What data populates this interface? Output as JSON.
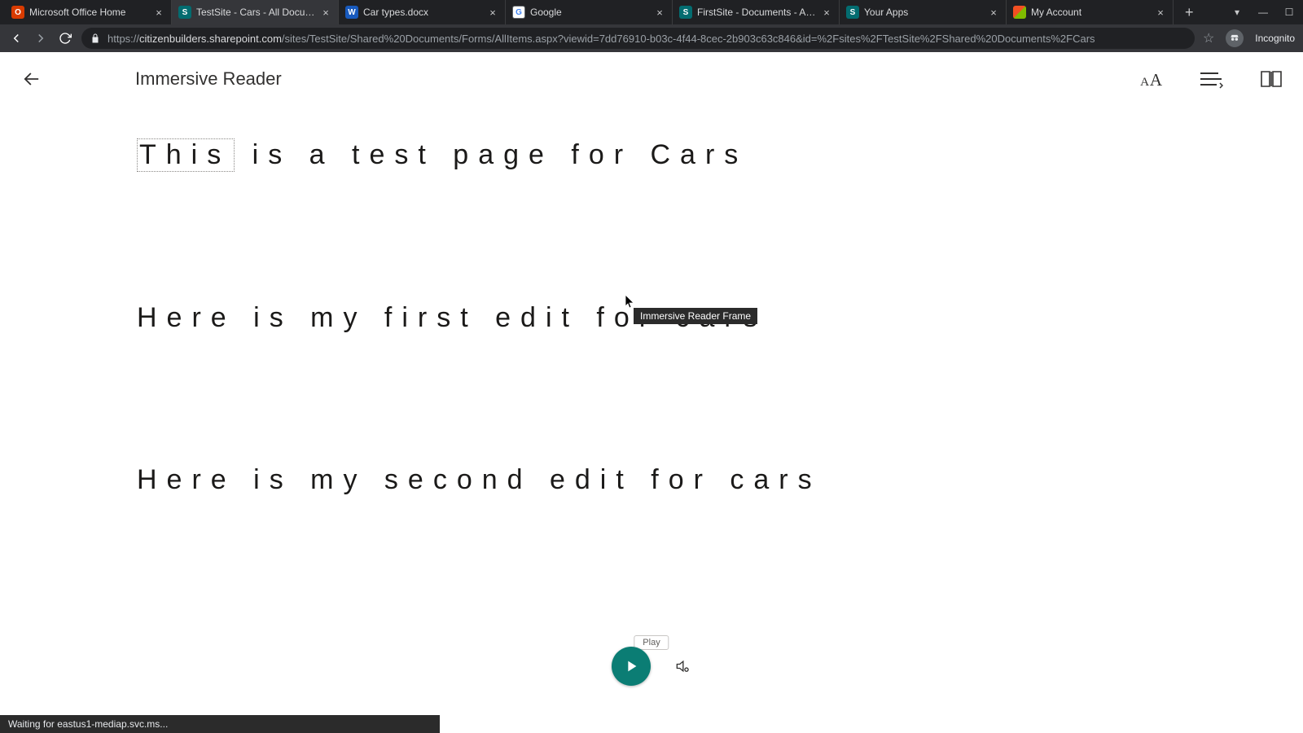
{
  "browser": {
    "tabs": [
      {
        "title": "Microsoft Office Home"
      },
      {
        "title": "TestSite - Cars - All Documents"
      },
      {
        "title": "Car types.docx"
      },
      {
        "title": "Google"
      },
      {
        "title": "FirstSite - Documents - All Docu"
      },
      {
        "title": "Your Apps"
      },
      {
        "title": "My Account"
      }
    ],
    "url_host": "citizenbuilders.sharepoint.com",
    "url_path": "/sites/TestSite/Shared%20Documents/Forms/AllItems.aspx?viewid=7dd76910-b03c-4f44-8cec-2b903c63c846&id=%2Fsites%2FTestSite%2FShared%20Documents%2FCars",
    "incognito_label": "Incognito"
  },
  "reader": {
    "title": "Immersive Reader",
    "line1_first_word": "This",
    "line1_rest": " is a test page for Cars",
    "line2": "Here is my first edit for cars",
    "line3": "Here is my second edit for cars",
    "tooltip": "Immersive Reader Frame",
    "play_label": "Play"
  },
  "status": "Waiting for eastus1-mediap.svc.ms..."
}
